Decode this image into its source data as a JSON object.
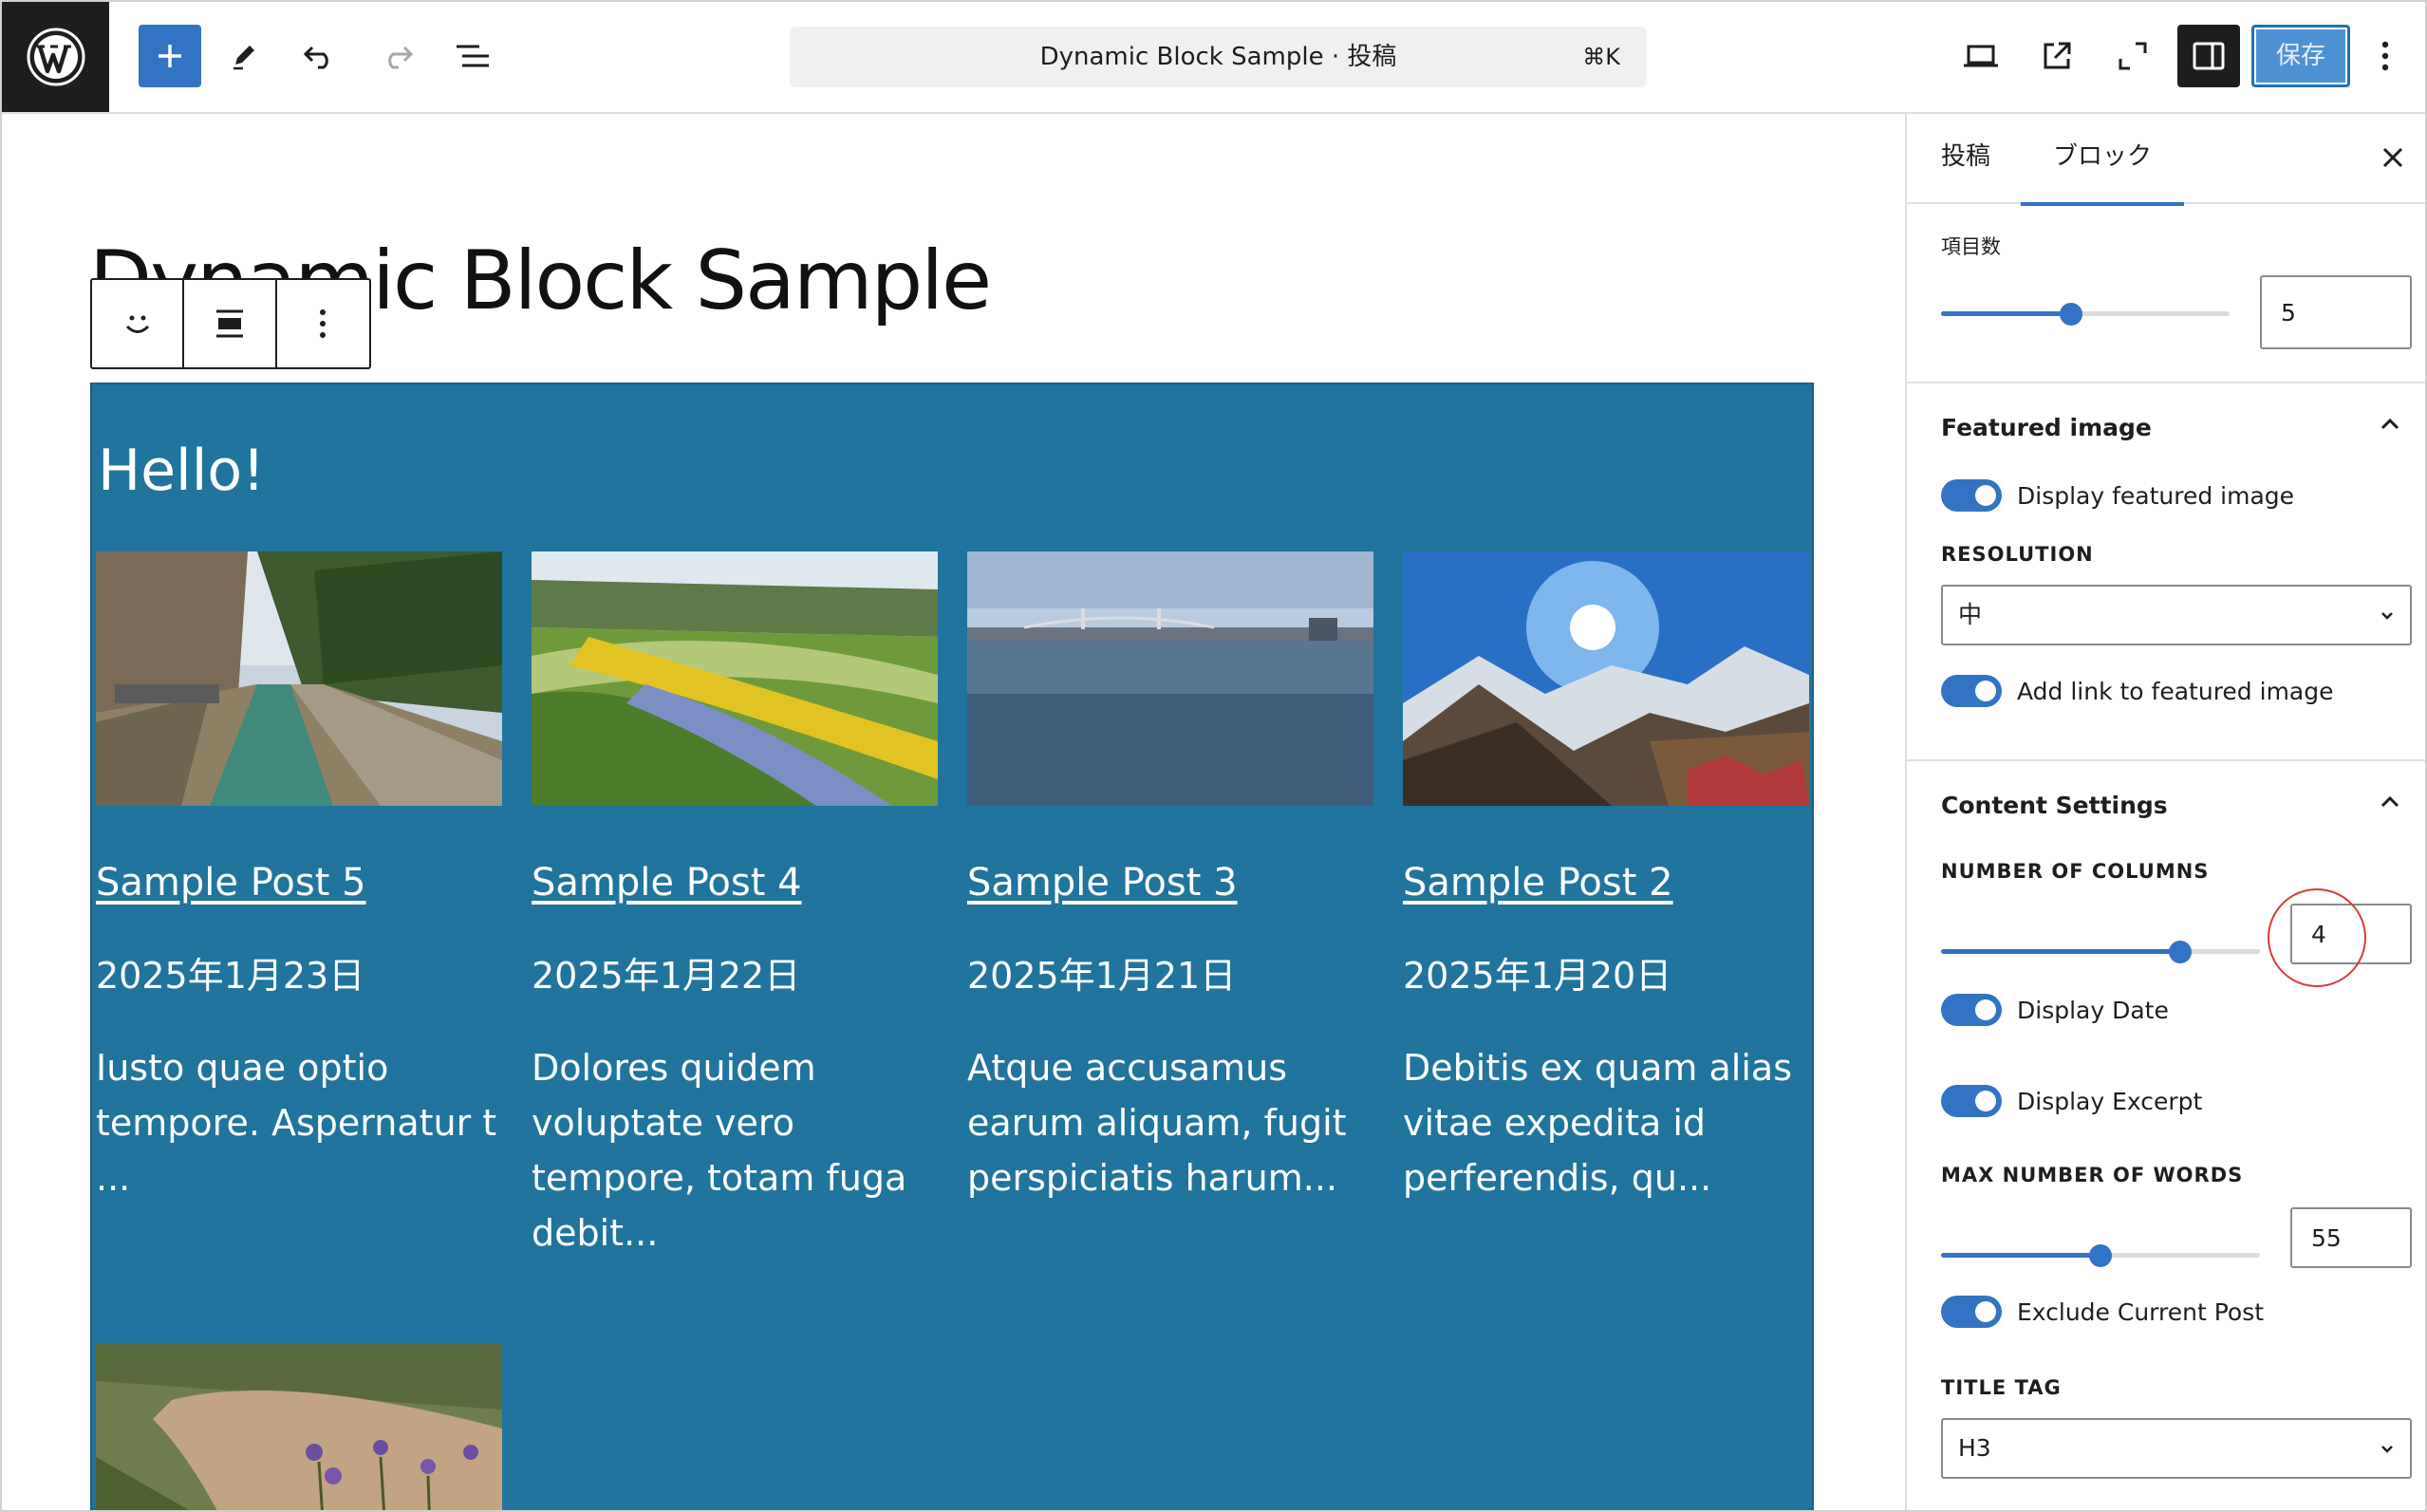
{
  "header": {
    "document_title": "Dynamic Block Sample · 投稿",
    "command_shortcut": "⌘K",
    "save_label": "保存"
  },
  "editor": {
    "post_title": "Dynamic Block Sample",
    "block_heading": "Hello!",
    "posts": [
      {
        "title": "Sample Post 5",
        "date": "2025年1月23日",
        "excerpt": "Iusto quae optio tempore. Aspernatur t ..."
      },
      {
        "title": "Sample Post 4",
        "date": "2025年1月22日",
        "excerpt": "Dolores quidem voluptate vero tempore, totam fuga debit..."
      },
      {
        "title": "Sample Post 3",
        "date": "2025年1月21日",
        "excerpt": "Atque accusamus earum aliquam, fugit perspiciatis harum..."
      },
      {
        "title": "Sample Post 2",
        "date": "2025年1月20日",
        "excerpt": "Debitis ex quam alias vitae expedita id perferendis, qu..."
      }
    ]
  },
  "sidebar": {
    "tabs": {
      "post": "投稿",
      "block": "ブロック"
    },
    "items_count": {
      "label": "項目数",
      "value": "5",
      "slider_fraction": 0.45
    },
    "featured_image": {
      "title": "Featured image",
      "display_toggle": "Display featured image",
      "resolution_label": "RESOLUTION",
      "resolution_value": "中",
      "link_toggle": "Add link to featured image"
    },
    "content_settings": {
      "title": "Content Settings",
      "columns_label": "NUMBER OF COLUMNS",
      "columns_value": "4",
      "columns_fraction": 0.75,
      "display_date": "Display Date",
      "display_excerpt": "Display Excerpt",
      "max_words_label": "MAX NUMBER OF WORDS",
      "max_words_value": "55",
      "max_words_fraction": 0.5,
      "exclude_current": "Exclude Current Post",
      "title_tag_label": "TITLE TAG",
      "title_tag_value": "H3"
    }
  },
  "colors": {
    "accent": "#3373c3",
    "block_background": "#20749d",
    "annotation": "#d93b3b"
  }
}
